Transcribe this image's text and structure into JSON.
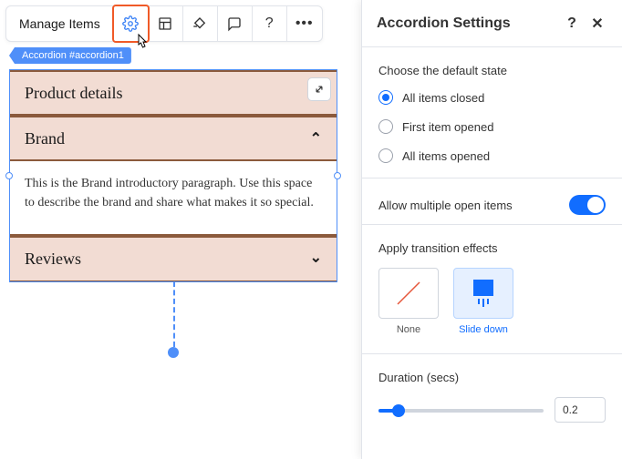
{
  "toolbar": {
    "manage_label": "Manage Items"
  },
  "breadcrumb": "Accordion #accordion1",
  "accordion": {
    "items": [
      {
        "title": "Product details"
      },
      {
        "title": "Brand",
        "body": "This is the Brand introductory paragraph. Use this space to describe the brand and share what makes it so special."
      },
      {
        "title": "Reviews"
      }
    ]
  },
  "panel": {
    "title": "Accordion Settings",
    "default_state_label": "Choose the default state",
    "radio": {
      "closed": "All items closed",
      "first": "First item opened",
      "all": "All items opened"
    },
    "allow_multiple_label": "Allow multiple open items",
    "transition_label": "Apply transition effects",
    "effects": {
      "none": "None",
      "slide": "Slide down"
    },
    "duration_label": "Duration (secs)",
    "duration_value": "0.2"
  }
}
